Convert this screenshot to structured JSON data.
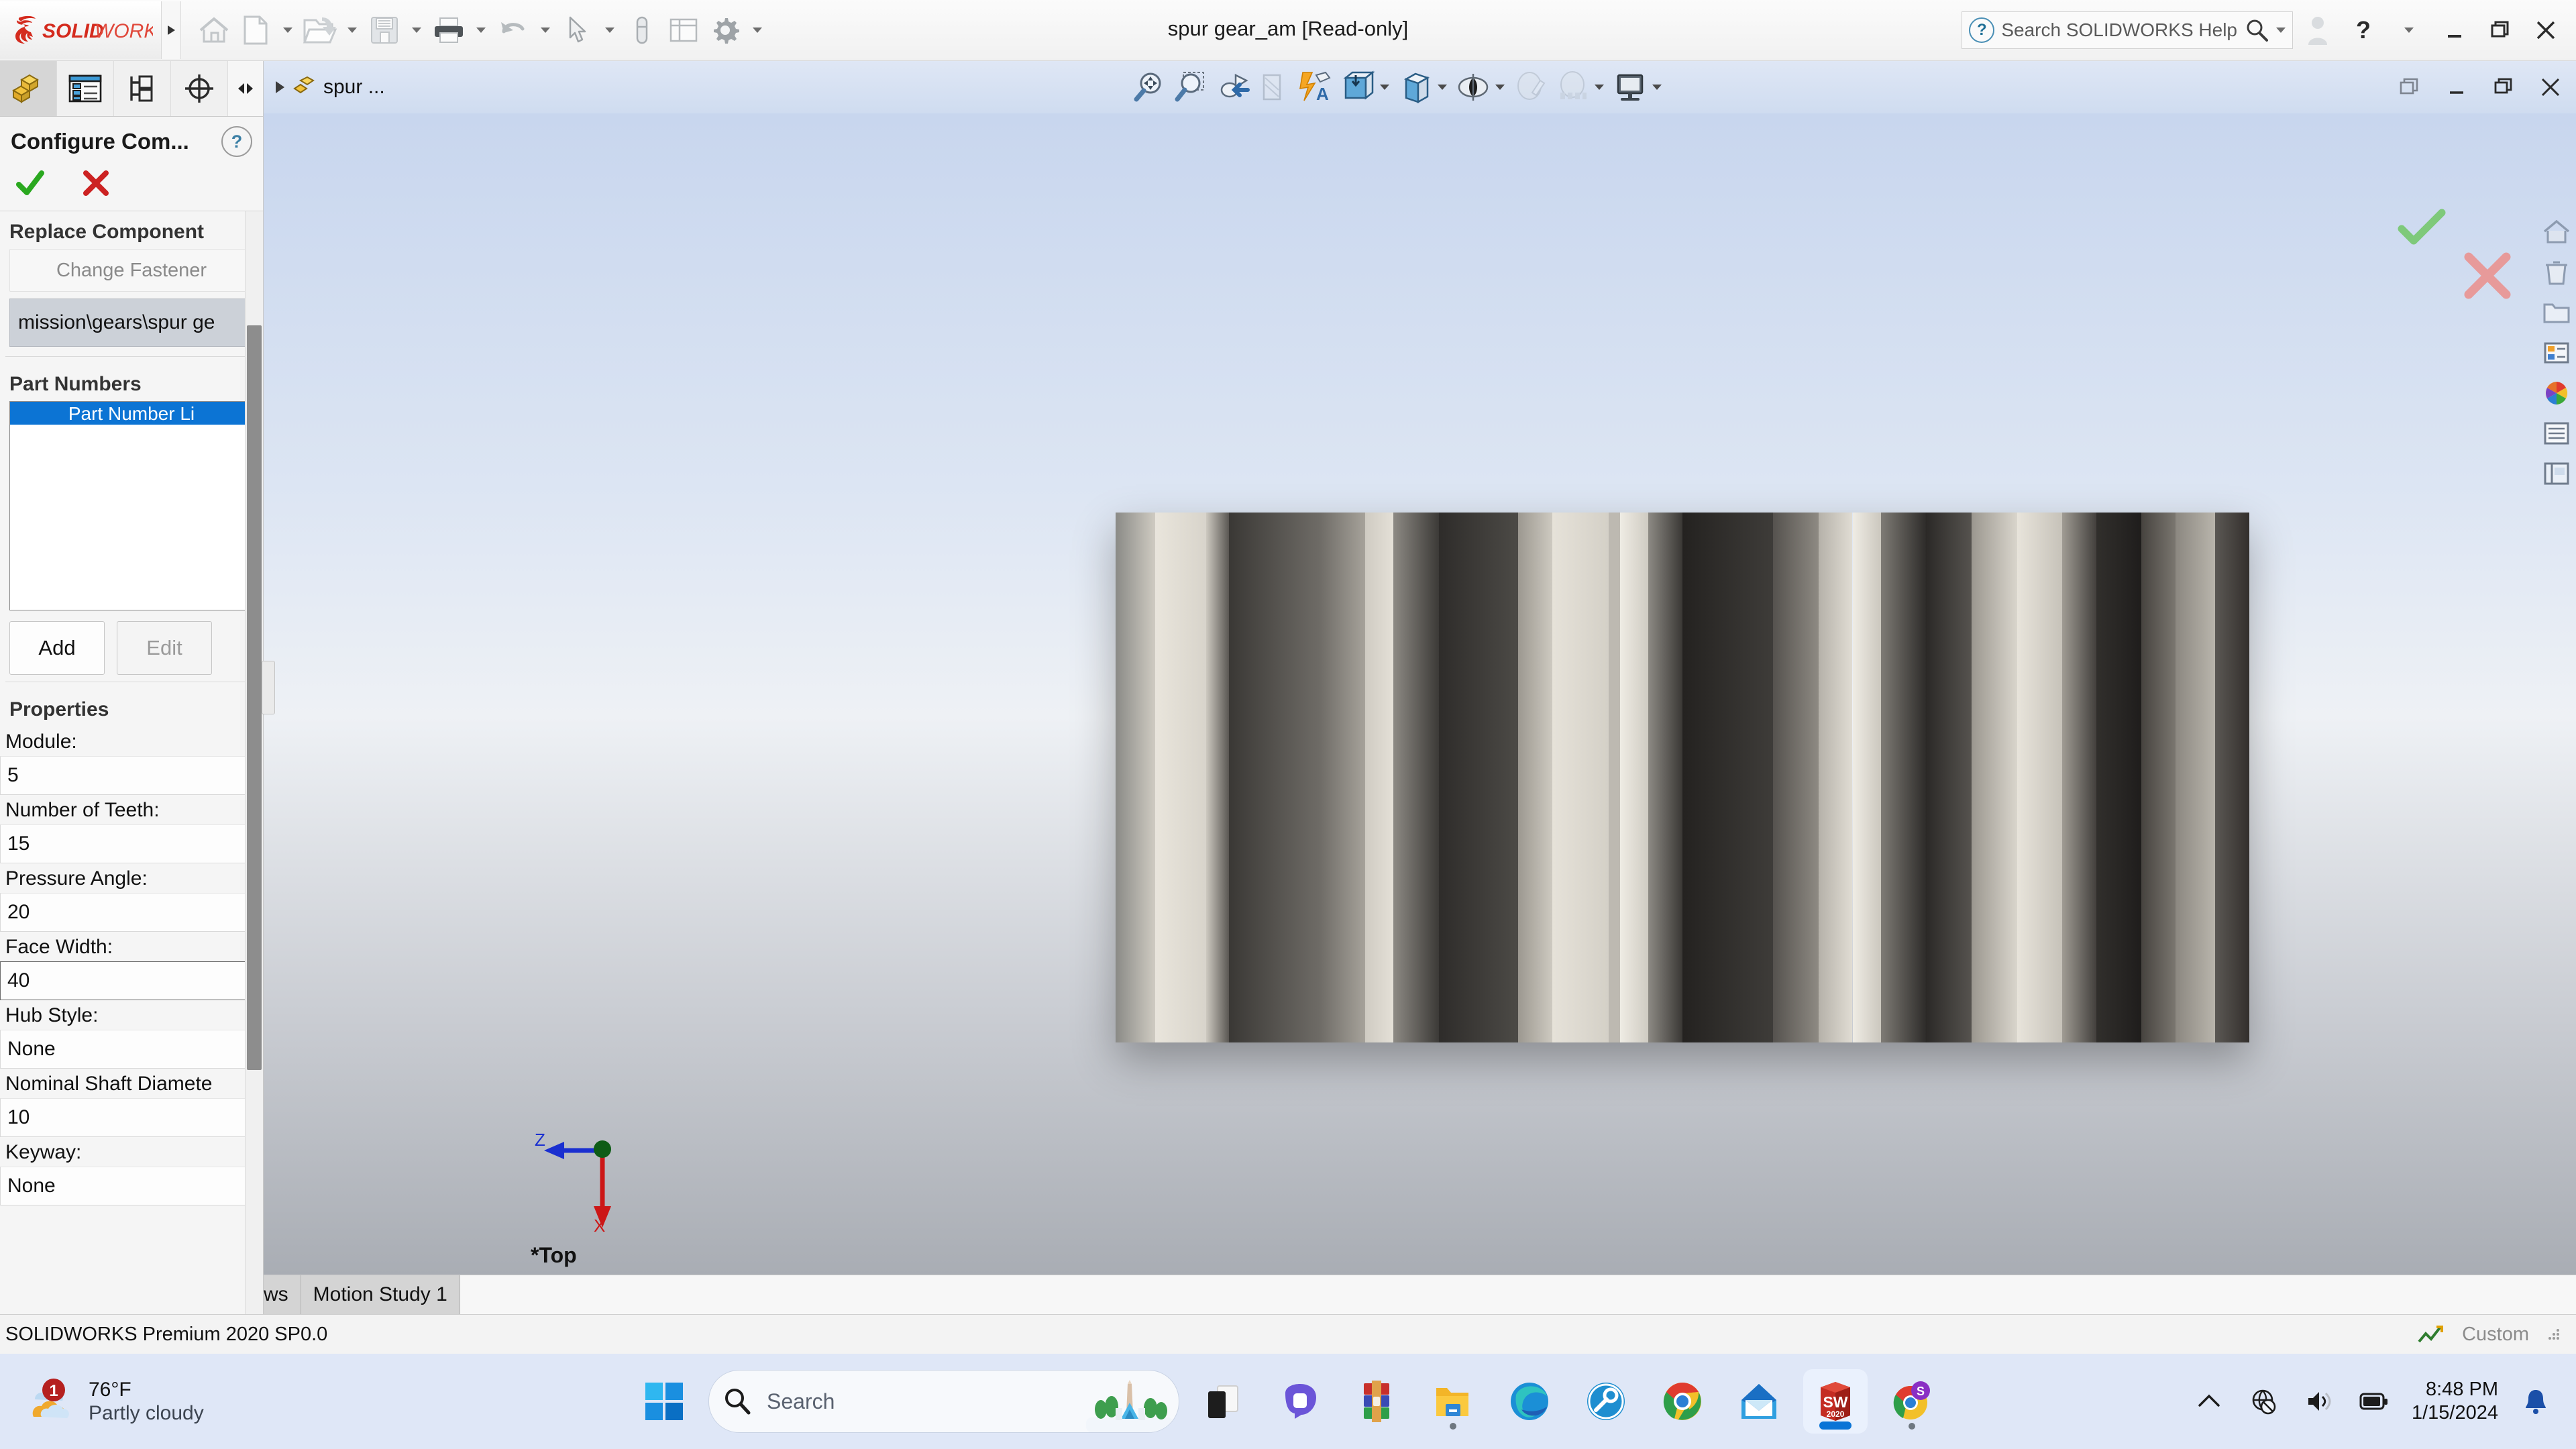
{
  "window": {
    "title": "spur gear_am [Read-only]",
    "help_search_placeholder": "Search SOLIDWORKS Help",
    "logo_text": "SOLIDWORKS"
  },
  "quick_access": {
    "items": [
      {
        "name": "home-icon",
        "label": "Home"
      },
      {
        "name": "new-document-icon",
        "label": "New"
      },
      {
        "name": "open-document-icon",
        "label": "Open"
      },
      {
        "name": "save-icon",
        "label": "Save"
      },
      {
        "name": "print-icon",
        "label": "Print"
      },
      {
        "name": "undo-icon",
        "label": "Undo"
      },
      {
        "name": "select-icon",
        "label": "Select"
      },
      {
        "name": "measure-icon",
        "label": "Measure"
      },
      {
        "name": "rebuild-icon",
        "label": "Rebuild"
      },
      {
        "name": "options-icon",
        "label": "Options"
      }
    ]
  },
  "title_bar_right": {
    "user_label": "User",
    "help_label": "?",
    "minimize_label": "Minimize",
    "restore_label": "Restore",
    "close_label": "Close"
  },
  "property_manager": {
    "tabs": [
      {
        "name": "feature-manager-tab",
        "label": "FeatureManager design tree",
        "active": true
      },
      {
        "name": "property-manager-tab",
        "label": "PropertyManager",
        "active": false
      },
      {
        "name": "configuration-manager-tab",
        "label": "ConfigurationManager",
        "active": false
      },
      {
        "name": "display-manager-tab",
        "label": "DisplayManager",
        "active": false
      }
    ],
    "title": "Configure Com...",
    "help_badge": "?",
    "accept_label": "OK",
    "cancel_label": "Cancel",
    "replace_component": {
      "heading": "Replace Component",
      "change_button": "Change Fastener",
      "path_value": "mission\\gears\\spur ge"
    },
    "part_numbers": {
      "heading": "Part Numbers",
      "column_header": "Part Number Li",
      "rows": [],
      "add_button": "Add",
      "edit_button": "Edit"
    },
    "properties": {
      "heading": "Properties",
      "fields": [
        {
          "label": "Module:",
          "value": "5"
        },
        {
          "label": "Number of Teeth:",
          "value": "15"
        },
        {
          "label": "Pressure Angle:",
          "value": "20"
        },
        {
          "label": "Face Width:",
          "value": "40",
          "focused": true
        },
        {
          "label": "Hub Style:",
          "value": "None"
        },
        {
          "label": "Nominal Shaft Diamete",
          "value": "10"
        },
        {
          "label": "Keyway:",
          "value": "None"
        }
      ]
    }
  },
  "graphics": {
    "breadcrumb": "spur ...",
    "view_orientation_label": "*Top",
    "triad": {
      "z_axis": "Z",
      "x_axis": "X"
    },
    "view_tools": [
      {
        "name": "zoom-to-fit-icon",
        "label": "Zoom to Fit"
      },
      {
        "name": "zoom-to-area-icon",
        "label": "Zoom to Area"
      },
      {
        "name": "previous-view-icon",
        "label": "Previous View"
      },
      {
        "name": "section-view-icon",
        "label": "Section View"
      },
      {
        "name": "dynamic-annotation-icon",
        "label": "Dynamic Annotation Views"
      },
      {
        "name": "view-orientation-icon",
        "label": "View Orientation"
      },
      {
        "name": "display-style-icon",
        "label": "Display Style"
      },
      {
        "name": "hide-show-items-icon",
        "label": "Hide/Show Items"
      },
      {
        "name": "edit-appearance-icon",
        "label": "Edit Appearance"
      },
      {
        "name": "apply-scene-icon",
        "label": "Apply Scene"
      },
      {
        "name": "view-settings-icon",
        "label": "View Settings"
      }
    ],
    "window_controls": {
      "restore": "Restore Down",
      "minimize": "Minimize",
      "maximize": "Maximize",
      "close": "Close"
    },
    "right_toolbar": [
      {
        "name": "home-view-icon",
        "label": "Home"
      },
      {
        "name": "delete-appearance-icon",
        "label": "Delete"
      },
      {
        "name": "folder-icon",
        "label": "Folder"
      },
      {
        "name": "appearances-icon",
        "label": "Appearances"
      },
      {
        "name": "color-wheel-icon",
        "label": "Colors"
      },
      {
        "name": "list-view-icon",
        "label": "List"
      },
      {
        "name": "display-pane-icon",
        "label": "Display Pane"
      }
    ],
    "confirm_corner": {
      "accept": "OK",
      "cancel": "Cancel"
    }
  },
  "bottom_tabs": [
    {
      "label": "ws",
      "name": "tab-model-views-partial"
    },
    {
      "label": "Motion Study 1",
      "name": "tab-motion-study-1"
    }
  ],
  "status_bar": {
    "text": "SOLIDWORKS Premium 2020 SP0.0",
    "custom_label": "Custom"
  },
  "taskbar": {
    "weather": {
      "temperature": "76°F",
      "condition": "Partly cloudy",
      "badge": "1"
    },
    "search_placeholder": "Search",
    "apps": [
      {
        "name": "taskview-icon",
        "label": "Task View"
      },
      {
        "name": "discord-icon",
        "label": "Discord"
      },
      {
        "name": "winrar-icon",
        "label": "WinRAR"
      },
      {
        "name": "file-explorer-icon",
        "label": "File Explorer"
      },
      {
        "name": "microsoft-edge-icon",
        "label": "Microsoft Edge"
      },
      {
        "name": "steam-icon",
        "label": "Steam"
      },
      {
        "name": "google-chrome-icon",
        "label": "Google Chrome"
      },
      {
        "name": "mail-icon",
        "label": "Mail"
      },
      {
        "name": "solidworks-icon",
        "label": "SOLIDWORKS 2020"
      },
      {
        "name": "chrome-secondary-icon",
        "label": "Chrome"
      }
    ],
    "tray": {
      "overflow": "Show hidden icons",
      "network": "Network - no internet",
      "volume": "Volume",
      "battery": "Battery",
      "time": "8:48 PM",
      "date": "1/15/2024",
      "notifications": "Notifications"
    }
  },
  "colors": {
    "brand_red": "#d42b1e",
    "accent_blue": "#0c74d4",
    "ok_green": "#2aa81f",
    "cancel_red": "#cc2222"
  }
}
